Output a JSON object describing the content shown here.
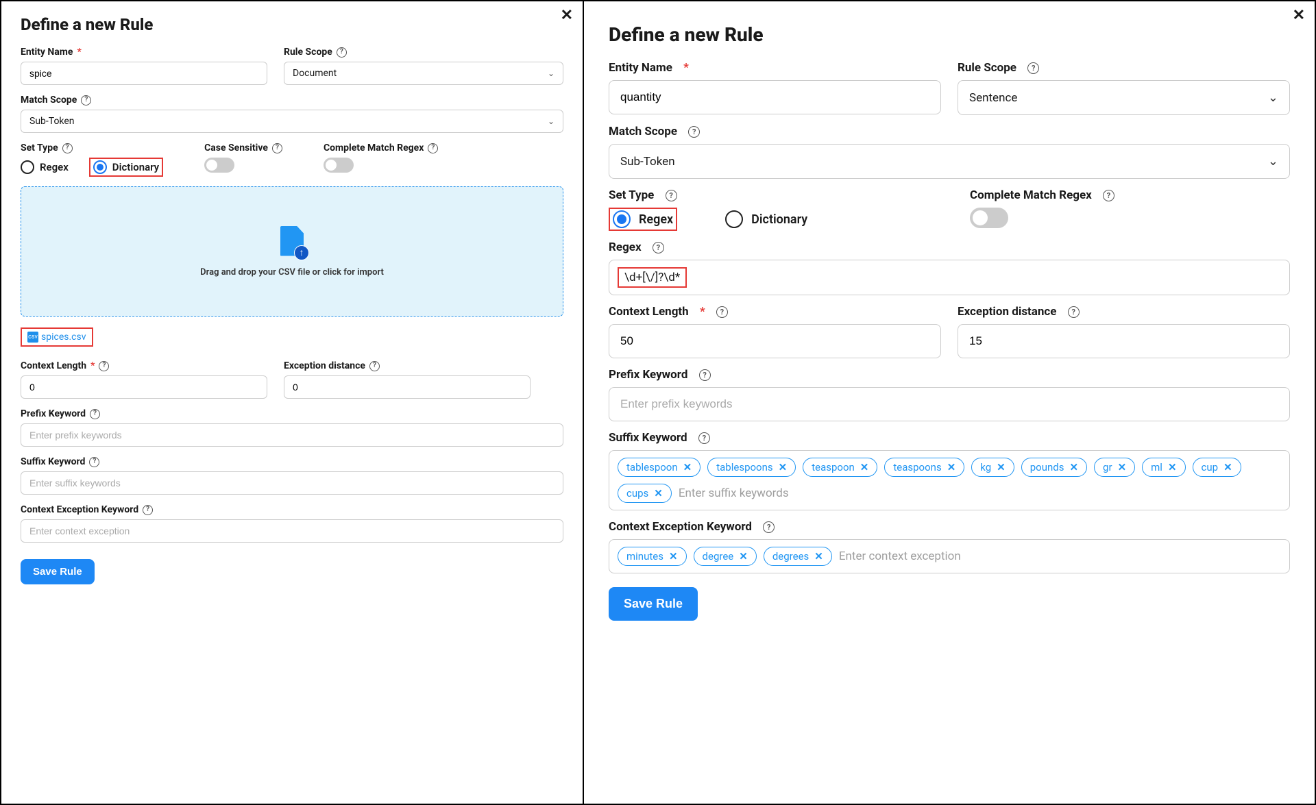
{
  "left": {
    "title": "Define a new Rule",
    "entity_name_label": "Entity Name",
    "entity_name_value": "spice",
    "rule_scope_label": "Rule Scope",
    "rule_scope_value": "Document",
    "match_scope_label": "Match Scope",
    "match_scope_value": "Sub-Token",
    "set_type_label": "Set Type",
    "radio_regex": "Regex",
    "radio_dictionary": "Dictionary",
    "set_type_selected": "Dictionary",
    "case_sensitive_label": "Case Sensitive",
    "complete_match_label": "Complete Match Regex",
    "dropzone_text": "Drag and drop your CSV file or click for import",
    "file_name": "spices.csv",
    "context_length_label": "Context Length",
    "context_length_value": "0",
    "exception_distance_label": "Exception distance",
    "exception_distance_value": "0",
    "prefix_keyword_label": "Prefix Keyword",
    "prefix_placeholder": "Enter prefix keywords",
    "suffix_keyword_label": "Suffix Keyword",
    "suffix_placeholder": "Enter suffix keywords",
    "context_exception_label": "Context Exception Keyword",
    "context_exception_placeholder": "Enter context exception",
    "save_label": "Save Rule"
  },
  "right": {
    "title": "Define a new Rule",
    "entity_name_label": "Entity Name",
    "entity_name_value": "quantity",
    "rule_scope_label": "Rule Scope",
    "rule_scope_value": "Sentence",
    "match_scope_label": "Match Scope",
    "match_scope_value": "Sub-Token",
    "set_type_label": "Set Type",
    "radio_regex": "Regex",
    "radio_dictionary": "Dictionary",
    "set_type_selected": "Regex",
    "complete_match_label": "Complete Match Regex",
    "regex_label": "Regex",
    "regex_value": "\\d+[\\/]?\\d*",
    "context_length_label": "Context Length",
    "context_length_value": "50",
    "exception_distance_label": "Exception distance",
    "exception_distance_value": "15",
    "prefix_keyword_label": "Prefix Keyword",
    "prefix_placeholder": "Enter prefix keywords",
    "suffix_keyword_label": "Suffix Keyword",
    "suffix_placeholder": "Enter suffix keywords",
    "suffix_tags": [
      "tablespoon",
      "tablespoons",
      "teaspoon",
      "teaspoons",
      "kg",
      "pounds",
      "gr",
      "ml",
      "cup",
      "cups"
    ],
    "context_exception_label": "Context Exception Keyword",
    "context_exception_placeholder": "Enter context exception",
    "context_exception_tags": [
      "minutes",
      "degree",
      "degrees"
    ],
    "save_label": "Save Rule"
  }
}
